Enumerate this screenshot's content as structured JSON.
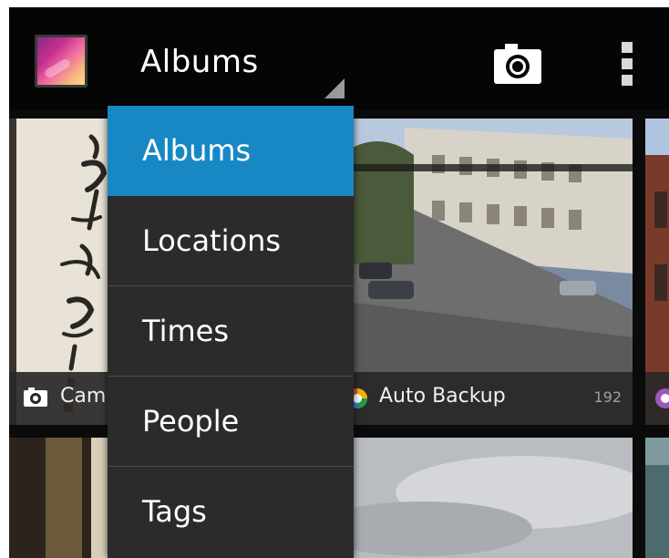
{
  "actionbar": {
    "title": "Albums",
    "icons": {
      "app": "gallery-app-icon",
      "camera": "camera-icon",
      "overflow": "overflow-menu-icon"
    }
  },
  "dropdown": {
    "items": [
      {
        "label": "Albums",
        "selected": true
      },
      {
        "label": "Locations",
        "selected": false
      },
      {
        "label": "Times",
        "selected": false
      },
      {
        "label": "People",
        "selected": false
      },
      {
        "label": "Tags",
        "selected": false
      }
    ],
    "selected_color": "#1788c4"
  },
  "albums": [
    {
      "name": "Cam",
      "icon": "camera-icon",
      "count": ""
    },
    {
      "name": "Auto Backup",
      "icon": "picasa-icon",
      "count": "192"
    }
  ]
}
